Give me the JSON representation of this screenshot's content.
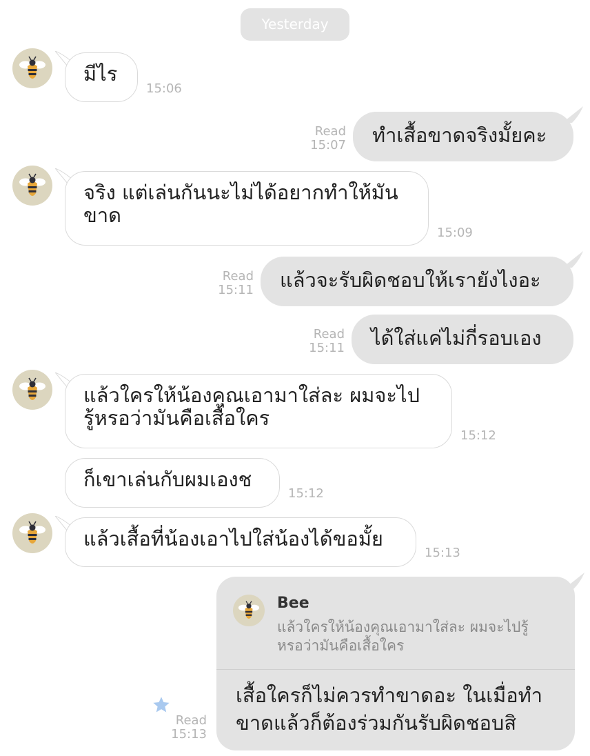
{
  "date_separator": "Yesterday",
  "sender_name": "Bee",
  "messages": [
    {
      "id": "m1",
      "direction": "in",
      "text": "มีไร",
      "time": "15:06"
    },
    {
      "id": "m2",
      "direction": "out",
      "text": "ทำเสื้อขาดจริงมั้ยคะ",
      "status": "Read",
      "time": "15:07"
    },
    {
      "id": "m3",
      "direction": "in",
      "lines": [
        "จริง แต่เล่นกันนะไม่ได้อยากทำให้มัน",
        "ขาด"
      ],
      "time": "15:09"
    },
    {
      "id": "m4",
      "direction": "out",
      "text": "แล้วจะรับผิดชอบให้เรายังไงอะ",
      "status": "Read",
      "time": "15:11"
    },
    {
      "id": "m5",
      "direction": "out",
      "text": "ได้ใส่แค่ไม่กี่รอบเอง",
      "status": "Read",
      "time": "15:11"
    },
    {
      "id": "m6",
      "direction": "in",
      "lines": [
        "แล้วใครให้น้องคุณเอามาใส่ละ ผมจะไป",
        "รู้หรอว่ามันคือเสื้อใคร"
      ],
      "time": "15:12"
    },
    {
      "id": "m7",
      "direction": "in",
      "text": "ก็เขาเล่นกับผมเองช",
      "time": "15:12"
    },
    {
      "id": "m8",
      "direction": "in",
      "text": "แล้วเสื้อที่น้องเอาไปใส่น้องได้ขอมั้ย",
      "time": "15:13"
    },
    {
      "id": "m9",
      "direction": "out",
      "reply_to": {
        "name": "Bee",
        "lines": [
          "แล้วใครให้น้องคุณเอามาใส่ละ ผมจะไปรู้",
          "หรอว่ามันคือเสื้อใคร"
        ]
      },
      "lines": [
        "เสื้อใครก็ไม่ควรทำขาดอะ ในเมื่อทำ",
        "ขาดแล้วก็ต้องร่วมกันรับผิดชอบสิ"
      ],
      "status": "Read",
      "time": "15:13",
      "starred": true
    }
  ],
  "colors": {
    "outgoing_bubble": "#e3e3e3",
    "incoming_border": "#dadada",
    "meta_text": "#b5b5b5",
    "star": "#a9c9ef"
  },
  "icons": {
    "avatar": "bee-icon",
    "star": "star-icon"
  }
}
